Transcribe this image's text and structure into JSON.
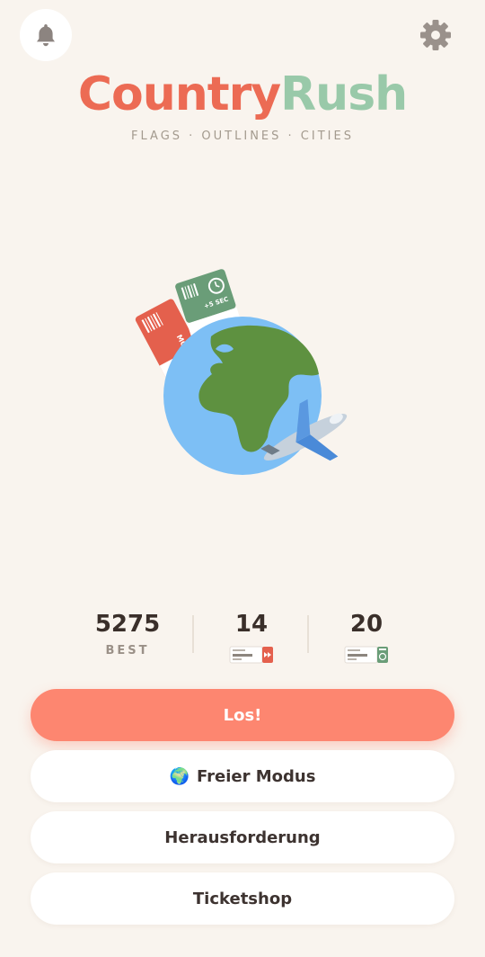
{
  "app": {
    "title_part1": "Country",
    "title_part2": "Rush",
    "subtitle": "FLAGS · OUTLINES · CITIES",
    "colors": {
      "accent": "#ec6b54",
      "secondary": "#99c9a9",
      "button": "#fd8670",
      "background": "#f9f4ee"
    }
  },
  "header": {
    "notifications_icon": "bell-icon",
    "settings_icon": "gear-icon"
  },
  "hero": {
    "image": "globe-with-airplane-and-tickets",
    "ticket_red_text": "MOK",
    "ticket_green_text": "+5 SEC"
  },
  "stats": {
    "best_value": "5275",
    "best_label": "BEST",
    "skip_tickets_value": "14",
    "skip_ticket_icon": "skip-ticket-icon",
    "time_tickets_value": "20",
    "time_ticket_icon": "time-ticket-icon"
  },
  "menu": {
    "play_label": "Los!",
    "free_mode_emoji": "🌍",
    "free_mode_label": "Freier Modus",
    "challenge_label": "Herausforderung",
    "shop_label": "Ticketshop"
  }
}
